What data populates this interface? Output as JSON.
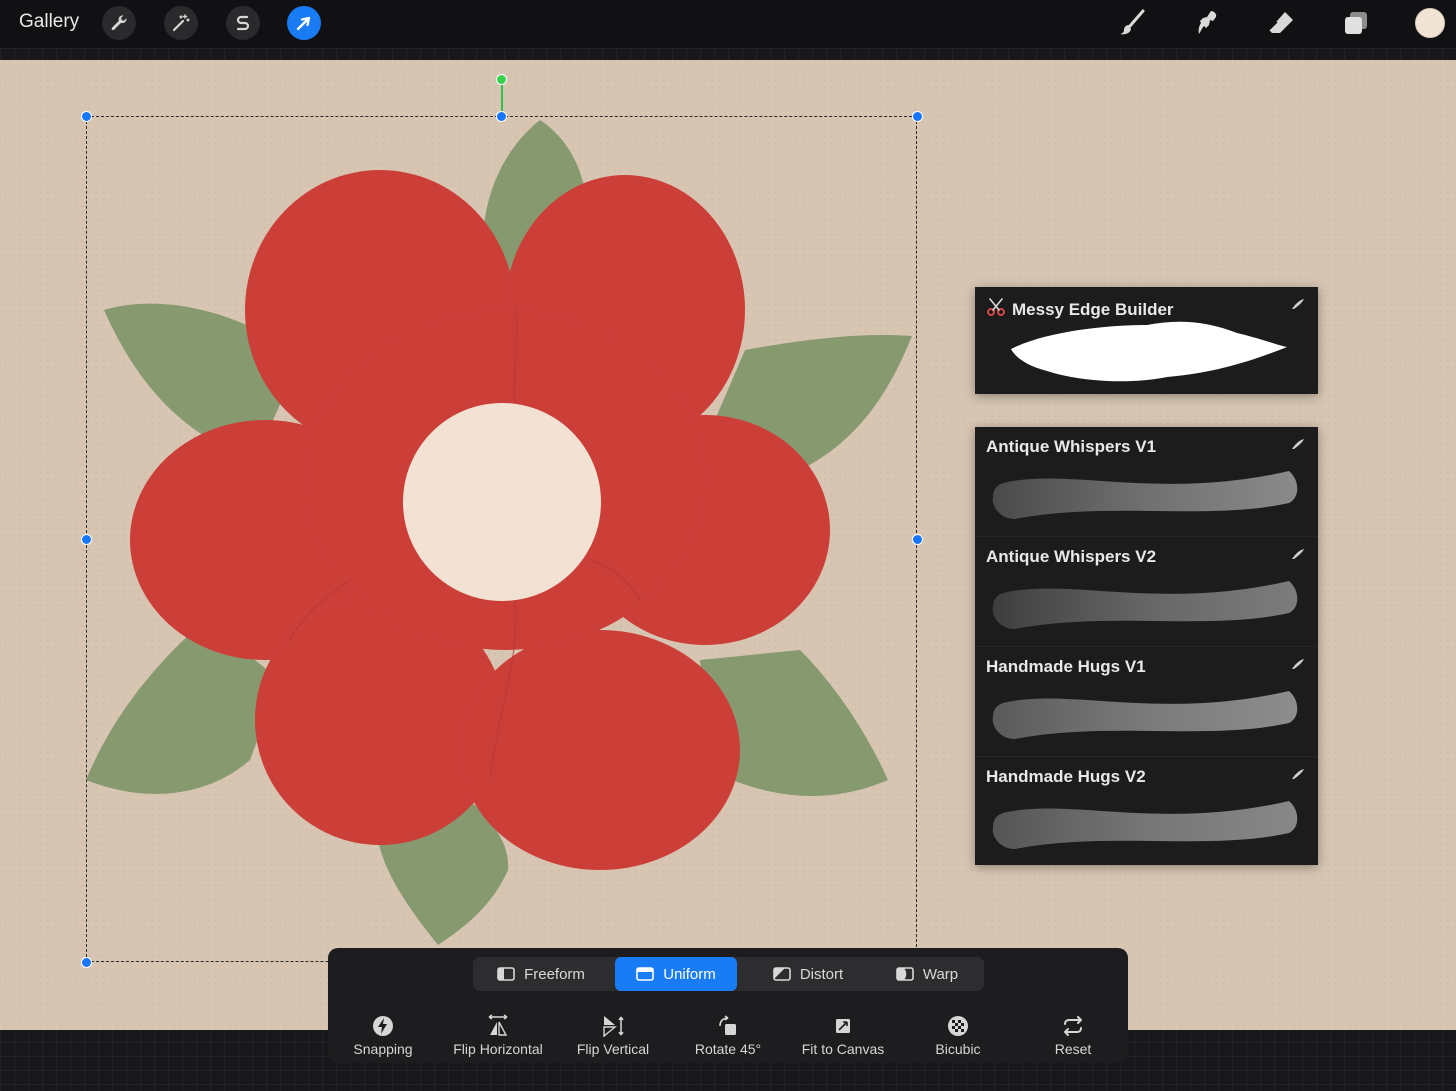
{
  "app": {
    "gallery_label": "Gallery"
  },
  "theme": {
    "accent": "#1a7cf5",
    "canvas": "#d7c5b2",
    "petal": "#cc3f39",
    "leaf": "#86996f",
    "center": "#f1e2d3",
    "current_color": "#f2e4d4"
  },
  "topbar": {
    "left_tools": [
      {
        "name": "actions",
        "icon": "wrench-icon",
        "active": false
      },
      {
        "name": "adjustments",
        "icon": "magic-wand-icon",
        "active": false
      },
      {
        "name": "selection",
        "icon": "selection-s-icon",
        "active": false
      },
      {
        "name": "transform",
        "icon": "arrow-cursor-icon",
        "active": true
      }
    ],
    "right_tools": [
      {
        "name": "brush",
        "icon": "brush-icon"
      },
      {
        "name": "smudge",
        "icon": "smudge-icon"
      },
      {
        "name": "eraser",
        "icon": "eraser-icon"
      },
      {
        "name": "layers",
        "icon": "layers-icon"
      }
    ]
  },
  "brushes": {
    "featured": {
      "name": "Messy Edge Builder",
      "icon": "scissors-icon"
    },
    "list": [
      {
        "name": "Antique Whispers V1"
      },
      {
        "name": "Antique Whispers V2"
      },
      {
        "name": "Handmade Hugs V1"
      },
      {
        "name": "Handmade Hugs V2"
      }
    ]
  },
  "transform": {
    "modes": [
      {
        "label": "Freeform",
        "icon": "freeform-icon",
        "active": false
      },
      {
        "label": "Uniform",
        "icon": "uniform-icon",
        "active": true
      },
      {
        "label": "Distort",
        "icon": "distort-icon",
        "active": false
      },
      {
        "label": "Warp",
        "icon": "warp-icon",
        "active": false
      }
    ],
    "actions": [
      {
        "label": "Snapping",
        "icon": "snapping-icon"
      },
      {
        "label": "Flip Horizontal",
        "icon": "flip-horizontal-icon"
      },
      {
        "label": "Flip Vertical",
        "icon": "flip-vertical-icon"
      },
      {
        "label": "Rotate 45°",
        "icon": "rotate-icon"
      },
      {
        "label": "Fit to Canvas",
        "icon": "fit-canvas-icon"
      },
      {
        "label": "Bicubic",
        "icon": "bicubic-icon"
      },
      {
        "label": "Reset",
        "icon": "reset-icon"
      }
    ]
  }
}
